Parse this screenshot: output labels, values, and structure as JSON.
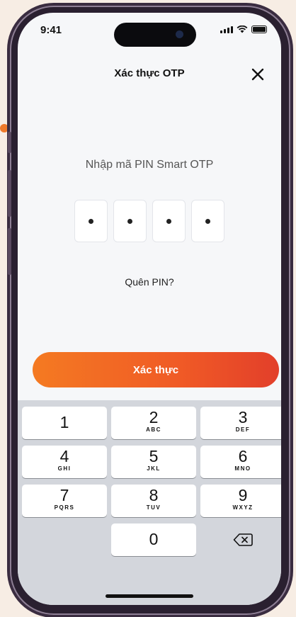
{
  "status_bar": {
    "time": "9:41"
  },
  "header": {
    "title": "Xác thực OTP"
  },
  "pin": {
    "label": "Nhập mã PIN Smart OTP",
    "digits": [
      "•",
      "•",
      "•",
      "•"
    ],
    "forgot_label": "Quên PIN?"
  },
  "confirm_button": {
    "label": "Xác thực"
  },
  "keypad": {
    "keys": [
      {
        "num": "1",
        "letters": ""
      },
      {
        "num": "2",
        "letters": "ABC"
      },
      {
        "num": "3",
        "letters": "DEF"
      },
      {
        "num": "4",
        "letters": "GHI"
      },
      {
        "num": "5",
        "letters": "JKL"
      },
      {
        "num": "6",
        "letters": "MNO"
      },
      {
        "num": "7",
        "letters": "PQRS"
      },
      {
        "num": "8",
        "letters": "TUV"
      },
      {
        "num": "9",
        "letters": "WXYZ"
      },
      {
        "num": "0",
        "letters": ""
      }
    ]
  },
  "colors": {
    "accent_start": "#f47a22",
    "accent_end": "#e23f2a"
  },
  "icons": [
    "close-icon",
    "backspace-icon",
    "signal-icon",
    "wifi-icon",
    "battery-icon"
  ]
}
